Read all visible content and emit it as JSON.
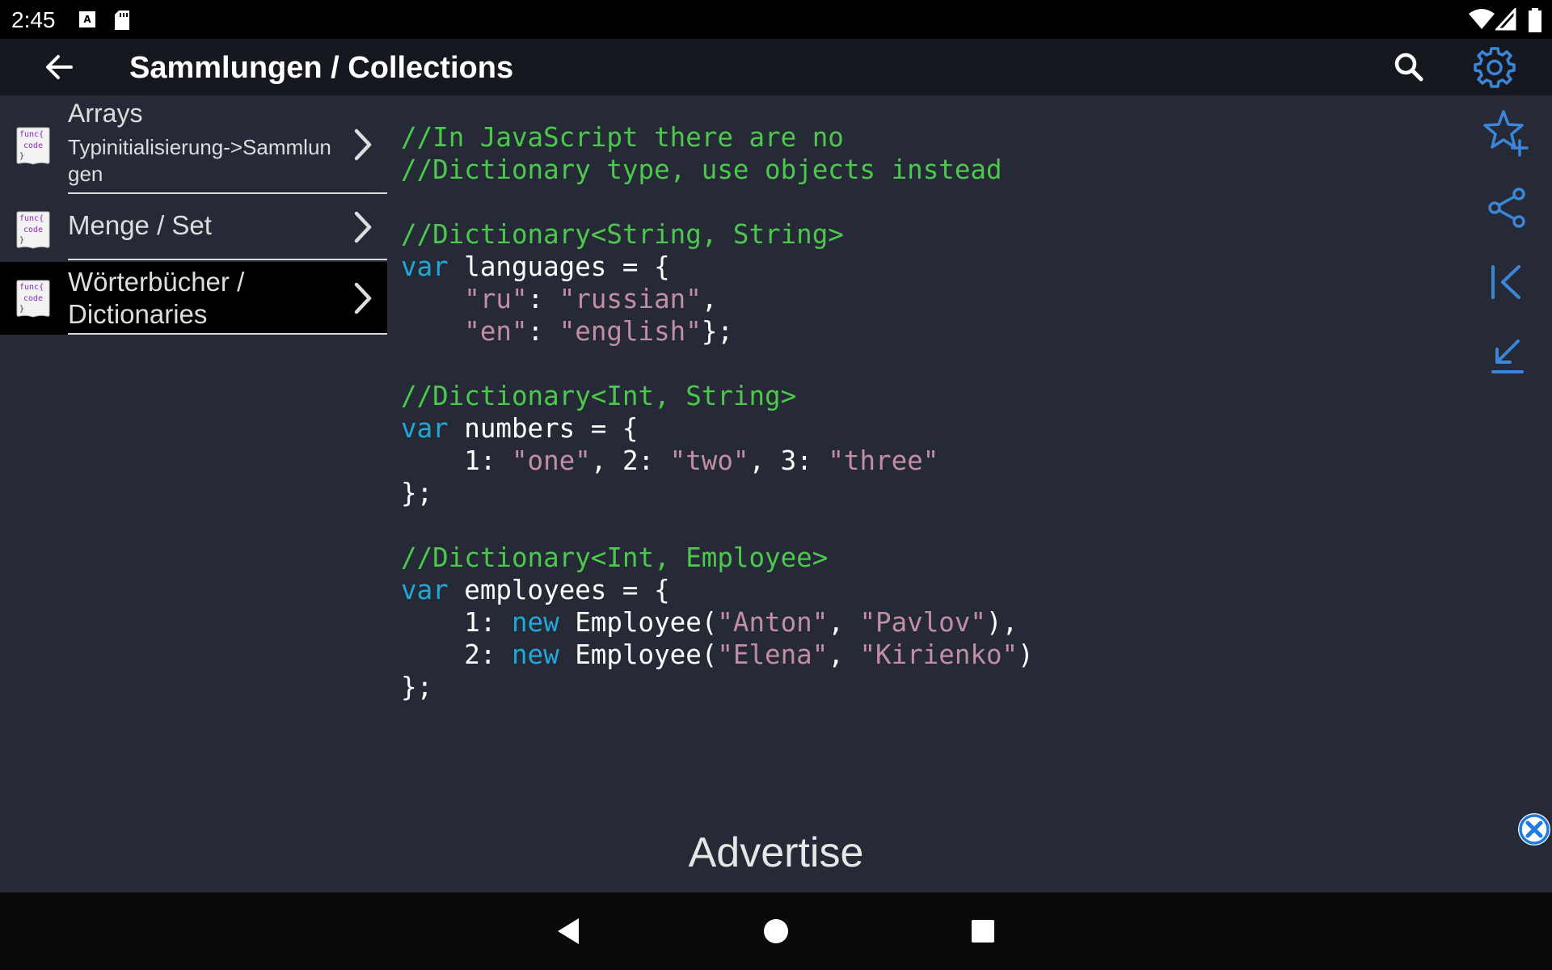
{
  "status_bar": {
    "time": "2:45",
    "icons": [
      "keyboard-a-icon",
      "sd-card-icon",
      "wifi-icon",
      "cell-signal-icon",
      "battery-icon"
    ]
  },
  "app_bar": {
    "title": "Sammlungen / Collections",
    "back_icon": "arrow-left-icon",
    "actions": [
      "search-icon",
      "gear-icon"
    ]
  },
  "sidebar": {
    "items": [
      {
        "title": "Arrays",
        "subtitle": "Typinitialisierung->Sammlun\ngen",
        "icon_text": [
          "func{",
          "code",
          "}"
        ],
        "selected": false
      },
      {
        "title": "Menge / Set",
        "subtitle": "",
        "icon_text": [
          "func{",
          "code",
          "}"
        ],
        "selected": false
      },
      {
        "title": "Wörterbücher /\nDictionaries",
        "subtitle": "",
        "icon_text": [
          "func{",
          "code",
          "}"
        ],
        "selected": true
      }
    ]
  },
  "code_lines": [
    [
      {
        "t": "//In JavaScript there are no",
        "c": "c"
      }
    ],
    [
      {
        "t": "//Dictionary type, use objects instead",
        "c": "c"
      }
    ],
    [],
    [
      {
        "t": "//Dictionary<String, String>",
        "c": "c"
      }
    ],
    [
      {
        "t": "var",
        "c": "k"
      },
      {
        "t": " languages = {",
        "c": "p"
      }
    ],
    [
      {
        "t": "    ",
        "c": "p"
      },
      {
        "t": "\"ru\"",
        "c": "s"
      },
      {
        "t": ": ",
        "c": "p"
      },
      {
        "t": "\"russian\"",
        "c": "s"
      },
      {
        "t": ",",
        "c": "p"
      }
    ],
    [
      {
        "t": "    ",
        "c": "p"
      },
      {
        "t": "\"en\"",
        "c": "s"
      },
      {
        "t": ": ",
        "c": "p"
      },
      {
        "t": "\"english\"",
        "c": "s"
      },
      {
        "t": "};",
        "c": "p"
      }
    ],
    [],
    [
      {
        "t": "//Dictionary<Int, String>",
        "c": "c"
      }
    ],
    [
      {
        "t": "var",
        "c": "k"
      },
      {
        "t": " numbers = {",
        "c": "p"
      }
    ],
    [
      {
        "t": "    1: ",
        "c": "p"
      },
      {
        "t": "\"one\"",
        "c": "s"
      },
      {
        "t": ", 2: ",
        "c": "p"
      },
      {
        "t": "\"two\"",
        "c": "s"
      },
      {
        "t": ", 3: ",
        "c": "p"
      },
      {
        "t": "\"three\"",
        "c": "s"
      }
    ],
    [
      {
        "t": "};",
        "c": "p"
      }
    ],
    [],
    [
      {
        "t": "//Dictionary<Int, Employee>",
        "c": "c"
      }
    ],
    [
      {
        "t": "var",
        "c": "k"
      },
      {
        "t": " employees = {",
        "c": "p"
      }
    ],
    [
      {
        "t": "    1: ",
        "c": "p"
      },
      {
        "t": "new",
        "c": "k"
      },
      {
        "t": " Employee(",
        "c": "p"
      },
      {
        "t": "\"Anton\"",
        "c": "s"
      },
      {
        "t": ", ",
        "c": "p"
      },
      {
        "t": "\"Pavlov\"",
        "c": "s"
      },
      {
        "t": "),",
        "c": "p"
      }
    ],
    [
      {
        "t": "    2: ",
        "c": "p"
      },
      {
        "t": "new",
        "c": "k"
      },
      {
        "t": " Employee(",
        "c": "p"
      },
      {
        "t": "\"Elena\"",
        "c": "s"
      },
      {
        "t": ", ",
        "c": "p"
      },
      {
        "t": "\"Kirienko\"",
        "c": "s"
      },
      {
        "t": ")",
        "c": "p"
      }
    ],
    [
      {
        "t": "};",
        "c": "p"
      }
    ]
  ],
  "right_rail": [
    "star-plus-icon",
    "share-icon",
    "jump-to-first-icon",
    "jump-to-last-icon"
  ],
  "advert": {
    "label": "Advertise",
    "close_icon": "close-circle-icon"
  },
  "nav_bar": [
    "nav-back-icon",
    "nav-home-icon",
    "nav-recents-icon"
  ],
  "colors": {
    "background": "#262a36",
    "app_bar": "#16181f",
    "comment": "#4cc94c",
    "keyword": "#1fa8d8",
    "string": "#c28ea4",
    "accent_icon": "#3b86d8"
  }
}
